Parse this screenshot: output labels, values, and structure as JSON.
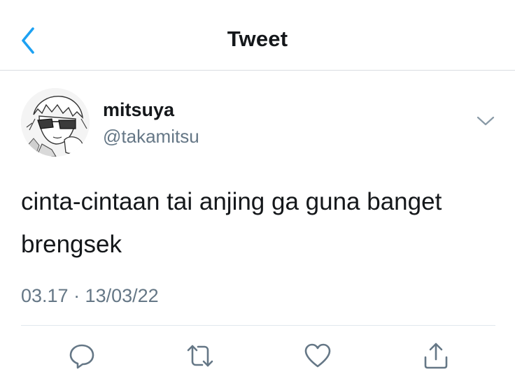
{
  "header": {
    "title": "Tweet",
    "back_icon": "chevron-left-icon"
  },
  "tweet": {
    "author": {
      "display_name": "mitsuya",
      "handle": "@takamitsu",
      "avatar": "manga-character-avatar"
    },
    "text": "cinta-cintaan tai anjing ga guna banget brengsek",
    "timestamp": "03.17 · 13/03/22",
    "more_icon": "chevron-down-icon"
  },
  "actions": [
    {
      "icon": "reply-icon"
    },
    {
      "icon": "retweet-icon"
    },
    {
      "icon": "like-icon"
    },
    {
      "icon": "share-icon"
    }
  ],
  "colors": {
    "accent": "#1da1f2",
    "text_primary": "#14171a",
    "text_secondary": "#657786",
    "divider": "#e1e8ed"
  }
}
